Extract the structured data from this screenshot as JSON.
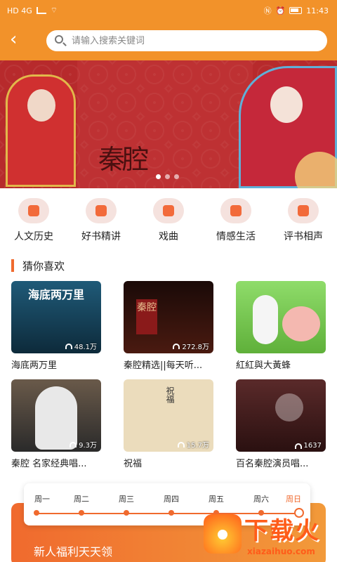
{
  "status_bar": {
    "left_text": "HD 4G",
    "time": "11:43"
  },
  "header": {
    "back_icon": "chevron-left-icon",
    "search": {
      "placeholder": "请输入搜索关键词"
    }
  },
  "banner": {
    "title_text": "秦腔",
    "carousel_index": 1,
    "carousel_total": 3
  },
  "categories": [
    {
      "label": "人文历史",
      "icon": "book-icon"
    },
    {
      "label": "好书精讲",
      "icon": "bookmark-book-icon"
    },
    {
      "label": "戏曲",
      "icon": "wifi-fan-icon"
    },
    {
      "label": "情感生活",
      "icon": "leaf-icon"
    },
    {
      "label": "评书相声",
      "icon": "ball-stick-icon"
    }
  ],
  "section": {
    "title": "猜你喜欢"
  },
  "items": [
    {
      "title": "海底两万里",
      "count": "48.1万",
      "thumb_text": "海底两万里",
      "color": "#2a6a8a"
    },
    {
      "title": "秦腔精选||每天听...",
      "count": "272.8万",
      "thumb_text": "秦腔",
      "color": "#3a1a12"
    },
    {
      "title": "紅紅與大黃蜂",
      "count": "",
      "thumb_text": "",
      "color": "#6fc24a"
    },
    {
      "title": "秦腔 名家经典唱...",
      "count": "9.3万",
      "thumb_text": "",
      "color": "#5a4a3a"
    },
    {
      "title": "祝福",
      "count": "15.7万",
      "thumb_text": "祝福",
      "color": "#e6d6b6"
    },
    {
      "title": "百名秦腔演员唱...",
      "count": "1637",
      "thumb_text": "",
      "color": "#7a3a3a"
    }
  ],
  "week": {
    "days": [
      "周一",
      "周二",
      "周三",
      "周四",
      "周五",
      "周六",
      "周日"
    ],
    "active_day": "周日"
  },
  "promo": {
    "title": "新人福利天天领"
  },
  "watermark": {
    "big": "下载火",
    "small": "xiazaihuo.com"
  }
}
